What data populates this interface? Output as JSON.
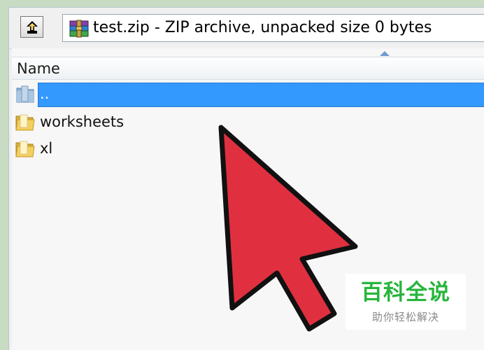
{
  "window": {
    "address_text": "test.zip - ZIP archive, unpacked size 0 bytes",
    "up_button_icon": "up-folder-icon",
    "archive_icon": "winrar-archive-icon"
  },
  "file_list": {
    "column_header": "Name",
    "sort_indicator": "sort-ascending-arrow",
    "rows": [
      {
        "name": "..",
        "icon": "parent-folder-icon",
        "selected": true
      },
      {
        "name": "worksheets",
        "icon": "folder-icon",
        "selected": false
      },
      {
        "name": "xl",
        "icon": "folder-icon",
        "selected": false
      }
    ]
  },
  "overlay": {
    "cursor_icon": "large-red-arrow-cursor",
    "cursor_color": "#e03040"
  },
  "watermark": {
    "title": "百科全说",
    "subtitle": "助你轻松解决",
    "title_color": "#27b53b"
  },
  "colors": {
    "selection": "#3399ff",
    "background": "#c7dcc3"
  }
}
